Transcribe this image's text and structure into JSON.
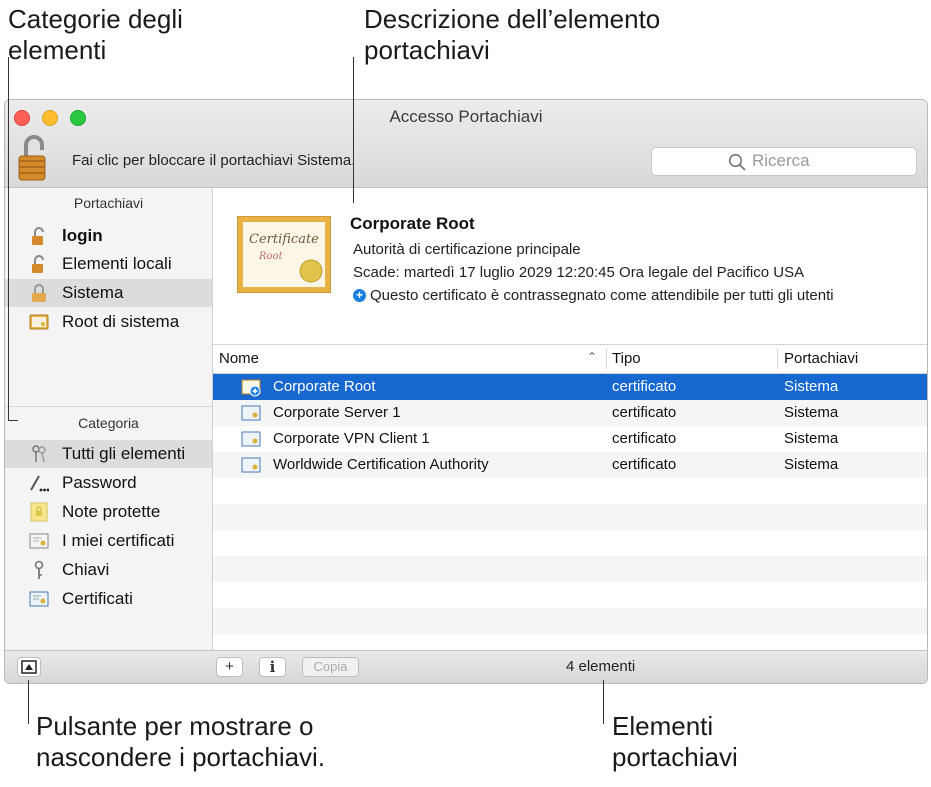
{
  "callouts": {
    "top_left": [
      "Categorie degli",
      "elementi"
    ],
    "top_right": [
      "Descrizione dell’elemento",
      "portachiavi"
    ],
    "bottom_left": [
      "Pulsante per mostrare o",
      "nascondere i portachiavi."
    ],
    "bottom_right": [
      "Elementi",
      "portachiavi"
    ]
  },
  "window": {
    "title": "Accesso Portachiavi",
    "lock_message": "Fai clic per bloccare il portachiavi Sistema.",
    "search_placeholder": "Ricerca"
  },
  "sidebar": {
    "keychains_header": "Portachiavi",
    "keychains": [
      {
        "label": "login",
        "icon": "padlock-open-icon",
        "bold": true
      },
      {
        "label": "Elementi locali",
        "icon": "padlock-open-icon"
      },
      {
        "label": "Sistema",
        "icon": "padlock-open-icon",
        "selected": true
      },
      {
        "label": "Root di sistema",
        "icon": "certificate-folder-icon"
      }
    ],
    "category_header": "Categoria",
    "categories": [
      {
        "label": "Tutti gli elementi",
        "icon": "keys-icon",
        "selected": true
      },
      {
        "label": "Password",
        "icon": "password-icon"
      },
      {
        "label": "Note protette",
        "icon": "secure-note-icon"
      },
      {
        "label": "I miei certificati",
        "icon": "my-certificate-icon"
      },
      {
        "label": "Chiavi",
        "icon": "key-icon"
      },
      {
        "label": "Certificati",
        "icon": "certificate-icon"
      }
    ]
  },
  "detail": {
    "cert_text_1": "Certificate",
    "cert_text_2": "Root",
    "title": "Corporate Root",
    "subtitle": "Autorità di certificazione principale",
    "expires": "Scade: martedì 17 luglio 2029 12:20:45 Ora legale del Pacifico USA",
    "trust": "Questo certificato è contrassegnato come attendibile per tutti gli utenti"
  },
  "table": {
    "columns": [
      "Nome",
      "Tipo",
      "Portachiavi"
    ],
    "sort_indicator": "⌃",
    "rows": [
      {
        "name": "Corporate Root",
        "type": "certificato",
        "keychain": "Sistema",
        "selected": true
      },
      {
        "name": "Corporate Server 1",
        "type": "certificato",
        "keychain": "Sistema"
      },
      {
        "name": "Corporate VPN Client 1",
        "type": "certificato",
        "keychain": "Sistema"
      },
      {
        "name": "Worldwide Certification Authority",
        "type": "certificato",
        "keychain": "Sistema"
      }
    ]
  },
  "bottombar": {
    "add_label": "+",
    "info_label": "i",
    "copy_label": "Copia",
    "count": "4 elementi"
  },
  "colors": {
    "selection": "#1667cf",
    "accent_plus": "#1a7fe0"
  }
}
